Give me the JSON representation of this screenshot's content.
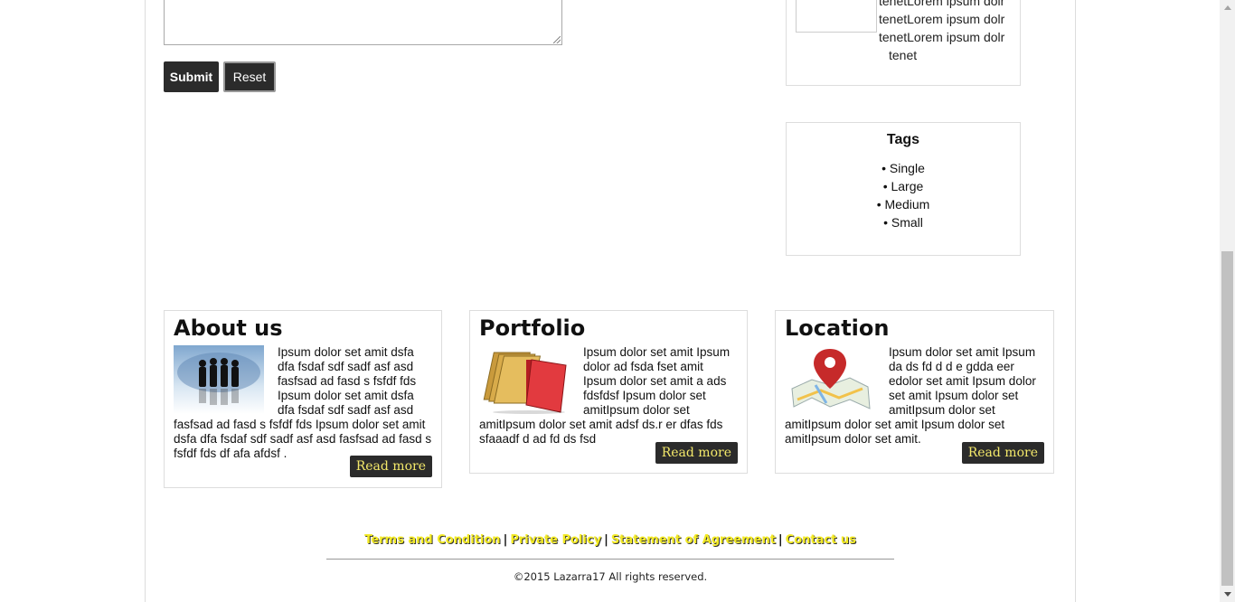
{
  "form": {
    "message_value": "",
    "submit_label": "Submit",
    "reset_label": "Reset"
  },
  "recent_posts": {
    "lines": [
      "tenetLorem ipsum dolr",
      "tenetLorem ipsum dolr",
      "tenetLorem ipsum dolr"
    ],
    "last_line": "tenet"
  },
  "tags": {
    "title": "Tags",
    "items": [
      "• Single",
      "• Large",
      "• Medium",
      "• Small"
    ]
  },
  "cards": [
    {
      "title": "About us",
      "image_icon": "people-silhouettes-image",
      "text": "Ipsum dolor set amit dsfa dfa fsdaf sdf sadf asf asd fasfsad ad fasd s fsfdf fds Ipsum dolor set amit dsfa dfa fsdaf sdf sadf asf asd fasfsad ad fasd s fsfdf fds Ipsum dolor set amit dsfa dfa fsdaf sdf sadf asf asd fasfsad ad fasd s fsfdf fds df afa afdsf .",
      "read_more": "Read more"
    },
    {
      "title": "Portfolio",
      "image_icon": "folders-image",
      "text": "Ipsum dolor set amit Ipsum dolor ad fsda fset amit Ipsum dolor set amit a ads fdsfdsf Ipsum dolor set amitIpsum dolor set amitIpsum dolor set amit adsf ds.r er dfas fds sfaaadf d ad fd ds fsd",
      "read_more": "Read more"
    },
    {
      "title": "Location",
      "image_icon": "map-pin-image",
      "text": "Ipsum dolor set amit Ipsum da ds fd d d e gdda eer edolor set amit Ipsum dolor set amit Ipsum dolor set amitIpsum dolor set amitIpsum dolor set amit Ipsum dolor set amitIpsum dolor set amit.",
      "read_more": "Read more"
    }
  ],
  "footer": {
    "links": [
      "Terms and Condition",
      "Private Policy",
      "Statement of Agreement",
      "Contact us"
    ],
    "separator": "|",
    "copyright": "©2015 Lazarra17 All rights reserved."
  },
  "colors": {
    "button_bg": "#2b2b2b",
    "read_more_text": "#f3e86a",
    "footer_link": "#f3ea23"
  }
}
